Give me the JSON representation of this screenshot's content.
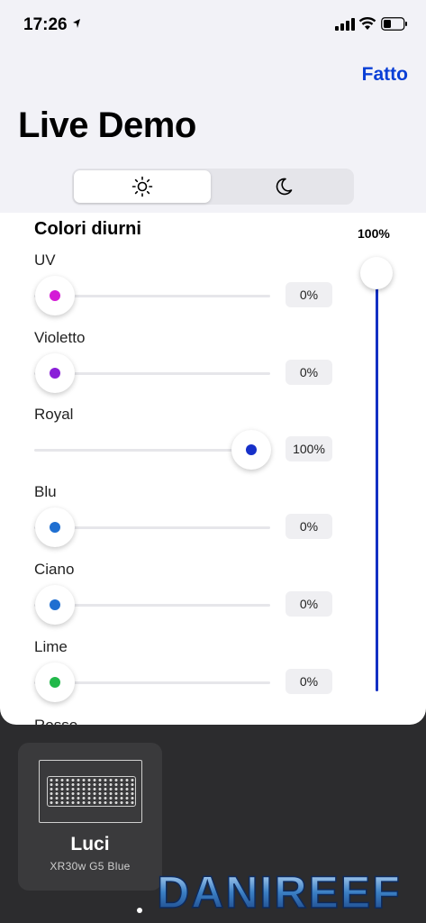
{
  "status_bar": {
    "time": "17:26"
  },
  "header": {
    "done_label": "Fatto",
    "title": "Live Demo"
  },
  "segmented": {
    "options": [
      "sun-icon",
      "moon-icon"
    ],
    "selected": 0
  },
  "section": {
    "title": "Colori diurni"
  },
  "master": {
    "value_label": "100%",
    "level": 1.0
  },
  "channels": [
    {
      "label": "UV",
      "value": "0%",
      "level": 0.0,
      "color": "#d41ad6"
    },
    {
      "label": "Violetto",
      "value": "0%",
      "level": 0.0,
      "color": "#8a1fd8"
    },
    {
      "label": "Royal",
      "value": "100%",
      "level": 1.0,
      "color": "#1630c9"
    },
    {
      "label": "Blu",
      "value": "0%",
      "level": 0.0,
      "color": "#1f6fd1"
    },
    {
      "label": "Ciano",
      "value": "0%",
      "level": 0.0,
      "color": "#1f6fd1"
    },
    {
      "label": "Lime",
      "value": "0%",
      "level": 0.0,
      "color": "#22b84a"
    }
  ],
  "cut_label": "Rosso",
  "device_card": {
    "name": "Luci",
    "model": "XR30w G5 Blue"
  },
  "watermark": {
    "text": "DANIREEF"
  },
  "colors": {
    "accent": "#0a3fd6",
    "master_track": "#1330c4"
  }
}
